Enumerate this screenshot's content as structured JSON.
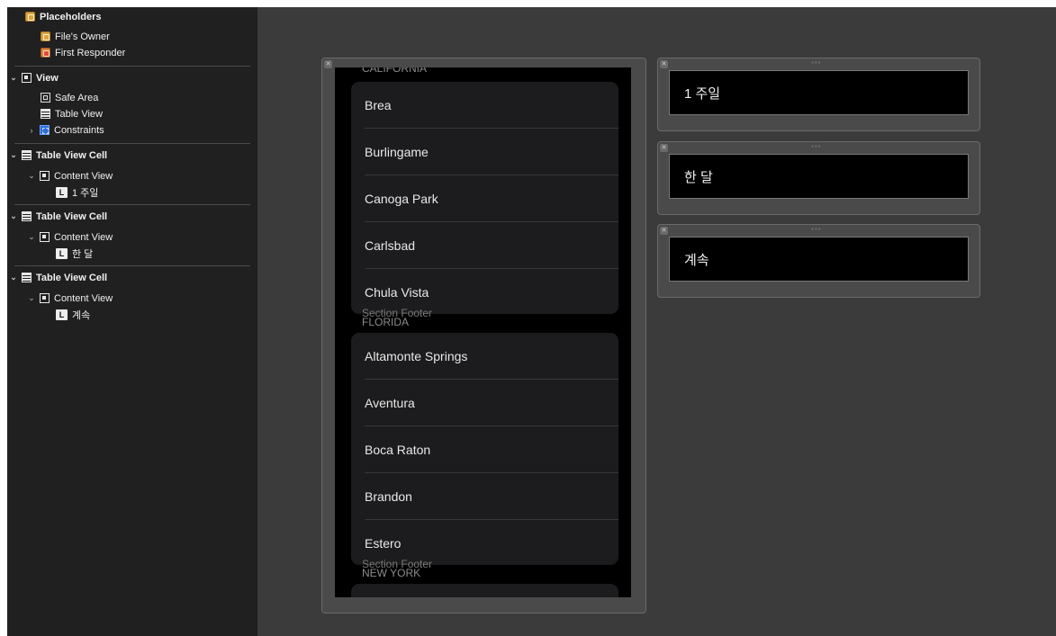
{
  "outline": {
    "placeholders_label": "Placeholders",
    "files_owner": "File's Owner",
    "first_responder": "First Responder",
    "view": "View",
    "safe_area": "Safe Area",
    "table_view": "Table View",
    "constraints": "Constraints",
    "cells": [
      {
        "cell_label": "Table View Cell",
        "content_view": "Content View",
        "label": "1 주일"
      },
      {
        "cell_label": "Table View Cell",
        "content_view": "Content View",
        "label": "한 달"
      },
      {
        "cell_label": "Table View Cell",
        "content_view": "Content View",
        "label": "계속"
      }
    ],
    "label_icon_glyph": "L"
  },
  "table_preview": {
    "top_clipped_header": "CALIFORNIA",
    "sections": [
      {
        "rows": [
          "Brea",
          "Burlingame",
          "Canoga Park",
          "Carlsbad",
          "Chula Vista"
        ],
        "footer": "Section Footer"
      },
      {
        "header": "FLORIDA",
        "rows": [
          "Altamonte Springs",
          "Aventura",
          "Boca Raton",
          "Brandon",
          "Estero"
        ],
        "footer": "Section Footer"
      },
      {
        "header": "NEW YORK",
        "rows": []
      }
    ]
  },
  "prototype_cells": [
    {
      "text": "1 주일"
    },
    {
      "text": "한 달"
    },
    {
      "text": "계속"
    }
  ],
  "colors": {
    "canvas_bg": "#3b3b3b",
    "sidebar_bg": "#202020",
    "cell_bg": "#1c1c1e",
    "separator": "#38383a"
  }
}
